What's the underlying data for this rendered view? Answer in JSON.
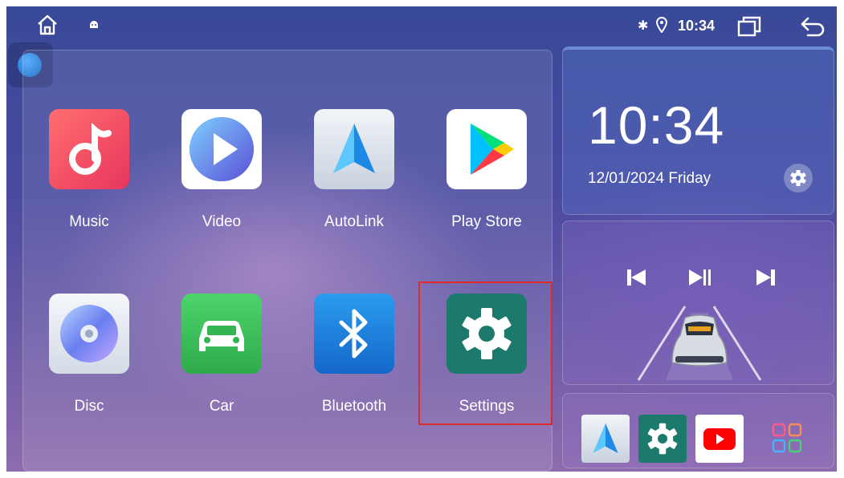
{
  "clock": {
    "time": "10:34",
    "date": "12/01/2024 Friday"
  },
  "status": {
    "time": "10:34"
  },
  "apps": [
    {
      "label": "Music"
    },
    {
      "label": "Video"
    },
    {
      "label": "AutoLink"
    },
    {
      "label": "Play Store"
    },
    {
      "label": "Disc"
    },
    {
      "label": "Car"
    },
    {
      "label": "Bluetooth"
    },
    {
      "label": "Settings"
    }
  ],
  "dock": {
    "items": [
      "autolink-icon",
      "settings-icon",
      "youtube-icon",
      "app-grid-icon"
    ]
  },
  "colors": {
    "settings_green": "#1b7a6b",
    "highlight": "#e02a2a",
    "car_green": "#3cb959",
    "bluetooth_blue": "#1e88e5"
  }
}
